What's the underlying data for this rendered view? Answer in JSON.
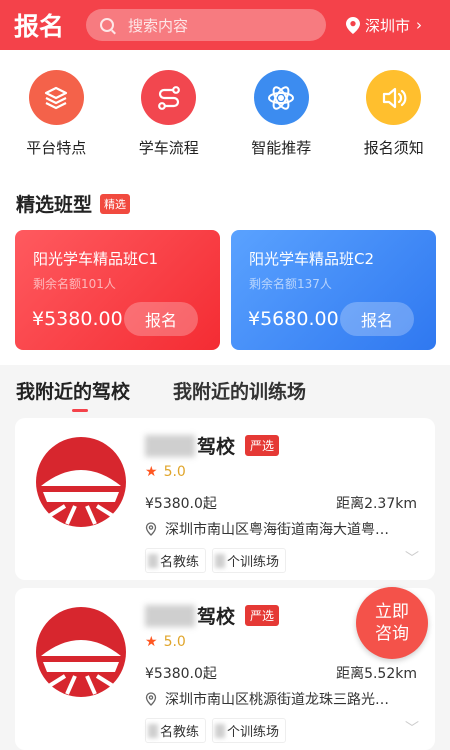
{
  "header": {
    "title": "报名",
    "search_placeholder": "搜索内容",
    "city": "深圳市"
  },
  "categories": [
    {
      "label": "平台特点",
      "icon": "layers-icon",
      "color": "#f4624a"
    },
    {
      "label": "学车流程",
      "icon": "route-icon",
      "color": "#f2474f"
    },
    {
      "label": "智能推荐",
      "icon": "atom-icon",
      "color": "#3c8cf0"
    },
    {
      "label": "报名须知",
      "icon": "speaker-icon",
      "color": "#ffbf2e"
    }
  ],
  "featured": {
    "title": "精选班型",
    "badge": "精选",
    "cards": [
      {
        "name": "阳光学车精品班C1",
        "remaining": "剩余名额101人",
        "price": "¥5380.00",
        "button": "报名"
      },
      {
        "name": "阳光学车精品班C2",
        "remaining": "剩余名额137人",
        "price": "¥5680.00",
        "button": "报名"
      }
    ]
  },
  "tabs": [
    {
      "label": "我附近的驾校",
      "active": true
    },
    {
      "label": "我附近的训练场",
      "active": false
    }
  ],
  "schools": [
    {
      "name_suffix": "驾校",
      "badge": "严选",
      "rating": "5.0",
      "price": "¥5380.0起",
      "distance": "距离2.37km",
      "address": "深圳市南山区粤海街道南海大道粤…",
      "chip1": "名教练",
      "chip2": "个训练场"
    },
    {
      "name_suffix": "驾校",
      "badge": "严选",
      "rating": "5.0",
      "price": "¥5380.0起",
      "distance": "距离5.52km",
      "address": "深圳市南山区桃源街道龙珠三路光…",
      "chip1": "名教练",
      "chip2": "个训练场"
    }
  ],
  "consult_button": {
    "line1": "立即",
    "line2": "咨询"
  }
}
